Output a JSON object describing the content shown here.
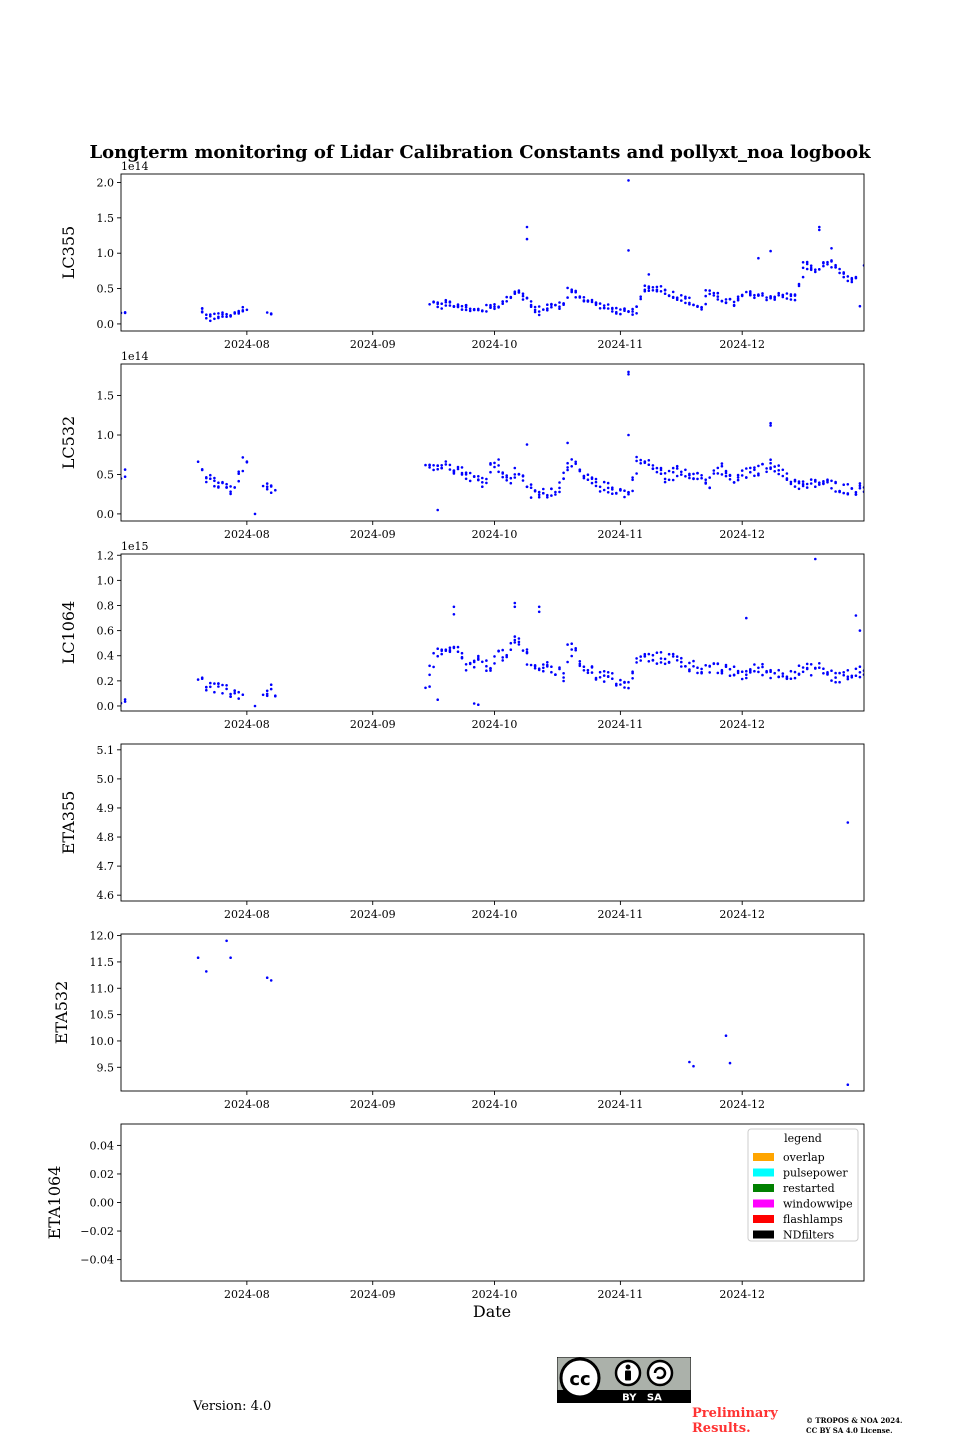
{
  "figure": {
    "title": "Longterm monitoring of Lidar Calibration Constants and pollyxt_noa logbook",
    "xlabel": "Date",
    "version_text": "Version: 4.0",
    "prelim_text": "Preliminary Results.",
    "copyright_line1": "© TROPOS & NOA 2024.",
    "copyright_line2": "CC BY SA 4.0 License.",
    "license_badge_text": "BY   SA",
    "point_color": "#0000ff"
  },
  "chart_data": [
    {
      "type": "scatter",
      "ylabel": "LC355",
      "offset_text": "1e14",
      "x_range": [
        "2024-07-01",
        "2024-12-31"
      ],
      "ylim": [
        -0.1,
        2.12
      ],
      "yticks": [
        0.0,
        0.5,
        1.0,
        1.5,
        2.0
      ],
      "ytick_labels": [
        "0.0",
        "0.5",
        "1.0",
        "1.5",
        "2.0"
      ],
      "xticks": [
        "2024-08-01",
        "2024-09-01",
        "2024-10-01",
        "2024-11-01",
        "2024-12-01"
      ],
      "xtick_labels": [
        "2024-08",
        "2024-09",
        "2024-10",
        "2024-11",
        "2024-12"
      ],
      "anchors": [
        [
          "2024-07-01",
          0.14
        ],
        [
          "2024-07-20",
          0.28
        ],
        [
          "2024-07-21",
          0.15
        ],
        [
          "2024-07-23",
          0.08
        ],
        [
          "2024-07-25",
          0.12
        ],
        [
          "2024-07-28",
          0.1
        ],
        [
          "2024-07-31",
          0.22
        ],
        [
          "2024-08-06",
          0.13
        ],
        [
          "2024-09-15",
          0.33
        ],
        [
          "2024-09-17",
          0.26
        ],
        [
          "2024-09-20",
          0.3
        ],
        [
          "2024-09-23",
          0.25
        ],
        [
          "2024-09-26",
          0.18
        ],
        [
          "2024-09-29",
          0.22
        ],
        [
          "2024-10-03",
          0.3
        ],
        [
          "2024-10-06",
          0.48
        ],
        [
          "2024-10-09",
          0.35
        ],
        [
          "2024-10-11",
          0.15
        ],
        [
          "2024-10-14",
          0.25
        ],
        [
          "2024-10-18",
          0.27
        ],
        [
          "2024-10-19",
          0.48
        ],
        [
          "2024-10-21",
          0.42
        ],
        [
          "2024-10-25",
          0.3
        ],
        [
          "2024-10-30",
          0.2
        ],
        [
          "2024-11-03",
          0.15
        ],
        [
          "2024-11-05",
          0.2
        ],
        [
          "2024-11-07",
          0.52
        ],
        [
          "2024-11-11",
          0.5
        ],
        [
          "2024-11-14",
          0.4
        ],
        [
          "2024-11-17",
          0.35
        ],
        [
          "2024-11-21",
          0.2
        ],
        [
          "2024-11-22",
          0.45
        ],
        [
          "2024-11-26",
          0.35
        ],
        [
          "2024-11-29",
          0.28
        ],
        [
          "2024-12-01",
          0.4
        ],
        [
          "2024-12-04",
          0.42
        ],
        [
          "2024-12-07",
          0.38
        ],
        [
          "2024-12-11",
          0.4
        ],
        [
          "2024-12-14",
          0.37
        ],
        [
          "2024-12-16",
          0.85
        ],
        [
          "2024-12-19",
          0.75
        ],
        [
          "2024-12-22",
          0.9
        ],
        [
          "2024-12-25",
          0.7
        ],
        [
          "2024-12-28",
          0.6
        ],
        [
          "2024-12-31",
          0.78
        ]
      ],
      "gaps": [
        [
          "2024-07-02",
          "2024-07-19"
        ],
        [
          "2024-08-01",
          "2024-08-05"
        ],
        [
          "2024-08-07",
          "2024-09-14"
        ],
        [
          "2024-12-29",
          "2024-12-30"
        ]
      ],
      "outliers": [
        [
          "2024-10-09",
          1.37
        ],
        [
          "2024-10-09",
          1.2
        ],
        [
          "2024-11-03",
          2.03
        ],
        [
          "2024-11-03",
          1.04
        ],
        [
          "2024-11-08",
          0.7
        ],
        [
          "2024-12-05",
          0.93
        ],
        [
          "2024-12-08",
          1.03
        ],
        [
          "2024-12-20",
          1.37
        ],
        [
          "2024-12-20",
          1.33
        ],
        [
          "2024-12-23",
          1.07
        ],
        [
          "2024-12-30",
          0.25
        ]
      ],
      "noise": 0.05,
      "density": 2.6
    },
    {
      "type": "scatter",
      "ylabel": "LC532",
      "offset_text": "1e14",
      "x_range": [
        "2024-07-01",
        "2024-12-31"
      ],
      "ylim": [
        -0.09,
        1.9
      ],
      "yticks": [
        0.0,
        0.5,
        1.0,
        1.5
      ],
      "ytick_labels": [
        "0.0",
        "0.5",
        "1.0",
        "1.5"
      ],
      "xticks": [
        "2024-08-01",
        "2024-09-01",
        "2024-10-01",
        "2024-11-01",
        "2024-12-01"
      ],
      "xtick_labels": [
        "2024-08",
        "2024-09",
        "2024-10",
        "2024-11",
        "2024-12"
      ],
      "anchors": [
        [
          "2024-07-01",
          0.5
        ],
        [
          "2024-07-20",
          0.65
        ],
        [
          "2024-07-22",
          0.45
        ],
        [
          "2024-07-25",
          0.35
        ],
        [
          "2024-07-29",
          0.3
        ],
        [
          "2024-07-31",
          0.65
        ],
        [
          "2024-08-05",
          0.3
        ],
        [
          "2024-08-07",
          0.35
        ],
        [
          "2024-09-14",
          0.65
        ],
        [
          "2024-09-17",
          0.6
        ],
        [
          "2024-09-20",
          0.62
        ],
        [
          "2024-09-24",
          0.5
        ],
        [
          "2024-09-28",
          0.4
        ],
        [
          "2024-10-01",
          0.7
        ],
        [
          "2024-10-04",
          0.4
        ],
        [
          "2024-10-07",
          0.55
        ],
        [
          "2024-10-10",
          0.25
        ],
        [
          "2024-10-13",
          0.25
        ],
        [
          "2024-10-17",
          0.35
        ],
        [
          "2024-10-19",
          0.68
        ],
        [
          "2024-10-23",
          0.45
        ],
        [
          "2024-10-27",
          0.35
        ],
        [
          "2024-10-31",
          0.3
        ],
        [
          "2024-11-03",
          0.25
        ],
        [
          "2024-11-05",
          0.68
        ],
        [
          "2024-11-09",
          0.6
        ],
        [
          "2024-11-12",
          0.45
        ],
        [
          "2024-11-15",
          0.55
        ],
        [
          "2024-11-20",
          0.5
        ],
        [
          "2024-11-23",
          0.35
        ],
        [
          "2024-11-25",
          0.6
        ],
        [
          "2024-11-29",
          0.4
        ],
        [
          "2024-12-01",
          0.5
        ],
        [
          "2024-12-05",
          0.55
        ],
        [
          "2024-12-08",
          0.65
        ],
        [
          "2024-12-12",
          0.45
        ],
        [
          "2024-12-16",
          0.35
        ],
        [
          "2024-12-20",
          0.4
        ],
        [
          "2024-12-24",
          0.35
        ],
        [
          "2024-12-28",
          0.3
        ],
        [
          "2024-12-31",
          0.35
        ]
      ],
      "gaps": [
        [
          "2024-07-02",
          "2024-07-19"
        ],
        [
          "2024-08-01",
          "2024-08-04"
        ],
        [
          "2024-08-08",
          "2024-09-13"
        ]
      ],
      "outliers": [
        [
          "2024-11-03",
          1.8
        ],
        [
          "2024-11-03",
          1.77
        ],
        [
          "2024-11-03",
          1.0
        ],
        [
          "2024-12-08",
          1.15
        ],
        [
          "2024-12-08",
          1.12
        ],
        [
          "2024-10-09",
          0.88
        ],
        [
          "2024-10-19",
          0.9
        ],
        [
          "2024-08-03",
          0.0
        ],
        [
          "2024-09-17",
          0.05
        ]
      ],
      "noise": 0.07,
      "density": 2.6
    },
    {
      "type": "scatter",
      "ylabel": "LC1064",
      "offset_text": "1e15",
      "x_range": [
        "2024-07-01",
        "2024-12-31"
      ],
      "ylim": [
        -0.04,
        1.21
      ],
      "yticks": [
        0.0,
        0.2,
        0.4,
        0.6,
        0.8,
        1.0,
        1.2
      ],
      "ytick_labels": [
        "0.0",
        "0.2",
        "0.4",
        "0.6",
        "0.8",
        "1.0",
        "1.2"
      ],
      "xticks": [
        "2024-08-01",
        "2024-09-01",
        "2024-10-01",
        "2024-11-01",
        "2024-12-01"
      ],
      "xtick_labels": [
        "2024-08",
        "2024-09",
        "2024-10",
        "2024-11",
        "2024-12"
      ],
      "anchors": [
        [
          "2024-07-01",
          0.06
        ],
        [
          "2024-07-20",
          0.2
        ],
        [
          "2024-07-23",
          0.15
        ],
        [
          "2024-07-26",
          0.12
        ],
        [
          "2024-07-30",
          0.1
        ],
        [
          "2024-08-05",
          0.1
        ],
        [
          "2024-08-07",
          0.12
        ],
        [
          "2024-09-14",
          0.1
        ],
        [
          "2024-09-16",
          0.4
        ],
        [
          "2024-09-19",
          0.42
        ],
        [
          "2024-09-22",
          0.45
        ],
        [
          "2024-09-24",
          0.3
        ],
        [
          "2024-09-27",
          0.35
        ],
        [
          "2024-09-30",
          0.3
        ],
        [
          "2024-10-01",
          0.42
        ],
        [
          "2024-10-04",
          0.38
        ],
        [
          "2024-10-06",
          0.55
        ],
        [
          "2024-10-09",
          0.4
        ],
        [
          "2024-10-11",
          0.3
        ],
        [
          "2024-10-15",
          0.3
        ],
        [
          "2024-10-18",
          0.22
        ],
        [
          "2024-10-19",
          0.5
        ],
        [
          "2024-10-22",
          0.35
        ],
        [
          "2024-10-26",
          0.25
        ],
        [
          "2024-10-30",
          0.22
        ],
        [
          "2024-11-03",
          0.15
        ],
        [
          "2024-11-05",
          0.38
        ],
        [
          "2024-11-10",
          0.38
        ],
        [
          "2024-11-14",
          0.38
        ],
        [
          "2024-11-18",
          0.32
        ],
        [
          "2024-11-22",
          0.3
        ],
        [
          "2024-11-27",
          0.28
        ],
        [
          "2024-12-01",
          0.25
        ],
        [
          "2024-12-05",
          0.3
        ],
        [
          "2024-12-10",
          0.25
        ],
        [
          "2024-12-15",
          0.28
        ],
        [
          "2024-12-20",
          0.3
        ],
        [
          "2024-12-24",
          0.22
        ],
        [
          "2024-12-28",
          0.25
        ],
        [
          "2024-12-31",
          0.3
        ]
      ],
      "gaps": [
        [
          "2024-07-02",
          "2024-07-19"
        ],
        [
          "2024-07-31",
          "2024-08-04"
        ],
        [
          "2024-08-08",
          "2024-09-13"
        ]
      ],
      "outliers": [
        [
          "2024-12-19",
          1.17
        ],
        [
          "2024-09-21",
          0.79
        ],
        [
          "2024-09-21",
          0.73
        ],
        [
          "2024-10-06",
          0.82
        ],
        [
          "2024-10-06",
          0.79
        ],
        [
          "2024-10-12",
          0.79
        ],
        [
          "2024-10-12",
          0.75
        ],
        [
          "2024-12-02",
          0.7
        ],
        [
          "2024-12-29",
          0.72
        ],
        [
          "2024-12-30",
          0.6
        ],
        [
          "2024-09-17",
          0.05
        ],
        [
          "2024-09-26",
          0.02
        ],
        [
          "2024-09-27",
          0.01
        ],
        [
          "2024-08-03",
          0.0
        ]
      ],
      "noise": 0.05,
      "density": 2.4
    },
    {
      "type": "scatter",
      "ylabel": "ETA355",
      "offset_text": "",
      "x_range": [
        "2024-07-01",
        "2024-12-31"
      ],
      "ylim": [
        4.58,
        5.12
      ],
      "yticks": [
        4.6,
        4.7,
        4.8,
        4.9,
        5.0,
        5.1
      ],
      "ytick_labels": [
        "4.6",
        "4.7",
        "4.8",
        "4.9",
        "5.0",
        "5.1"
      ],
      "xticks": [
        "2024-08-01",
        "2024-09-01",
        "2024-10-01",
        "2024-11-01",
        "2024-12-01"
      ],
      "xtick_labels": [
        "2024-08",
        "2024-09",
        "2024-10",
        "2024-11",
        "2024-12"
      ],
      "points": [
        [
          "2024-12-27",
          4.85
        ]
      ]
    },
    {
      "type": "scatter",
      "ylabel": "ETA532",
      "offset_text": "",
      "x_range": [
        "2024-07-01",
        "2024-12-31"
      ],
      "ylim": [
        9.05,
        12.03
      ],
      "yticks": [
        9.5,
        10.0,
        10.5,
        11.0,
        11.5,
        12.0
      ],
      "ytick_labels": [
        "9.5",
        "10.0",
        "10.5",
        "11.0",
        "11.5",
        "12.0"
      ],
      "xticks": [
        "2024-08-01",
        "2024-09-01",
        "2024-10-01",
        "2024-11-01",
        "2024-12-01"
      ],
      "xtick_labels": [
        "2024-08",
        "2024-09",
        "2024-10",
        "2024-11",
        "2024-12"
      ],
      "points": [
        [
          "2024-07-20",
          11.58
        ],
        [
          "2024-07-22",
          11.32
        ],
        [
          "2024-07-27",
          11.9
        ],
        [
          "2024-07-28",
          11.58
        ],
        [
          "2024-08-06",
          11.2
        ],
        [
          "2024-08-07",
          11.15
        ],
        [
          "2024-11-18",
          9.6
        ],
        [
          "2024-11-19",
          9.52
        ],
        [
          "2024-11-27",
          10.1
        ],
        [
          "2024-11-28",
          9.58
        ],
        [
          "2024-12-27",
          9.17
        ]
      ]
    },
    {
      "type": "scatter",
      "ylabel": "ETA1064",
      "offset_text": "",
      "x_range": [
        "2024-07-01",
        "2024-12-31"
      ],
      "ylim": [
        -0.055,
        0.055
      ],
      "yticks": [
        -0.04,
        -0.02,
        0.0,
        0.02,
        0.04
      ],
      "ytick_labels": [
        "−0.04",
        "−0.02",
        "0.00",
        "0.02",
        "0.04"
      ],
      "xticks": [
        "2024-08-01",
        "2024-09-01",
        "2024-10-01",
        "2024-11-01",
        "2024-12-01"
      ],
      "xtick_labels": [
        "2024-08",
        "2024-09",
        "2024-10",
        "2024-11",
        "2024-12"
      ],
      "points": [],
      "legend": {
        "title": "legend",
        "placement": "top-right",
        "items": [
          {
            "label": "overlap",
            "color": "#ffa500"
          },
          {
            "label": "pulsepower",
            "color": "#00ffff"
          },
          {
            "label": "restarted",
            "color": "#008000"
          },
          {
            "label": "windowwipe",
            "color": "#ff00ff"
          },
          {
            "label": "flashlamps",
            "color": "#ff0000"
          },
          {
            "label": "NDfilters",
            "color": "#000000"
          }
        ]
      }
    }
  ]
}
